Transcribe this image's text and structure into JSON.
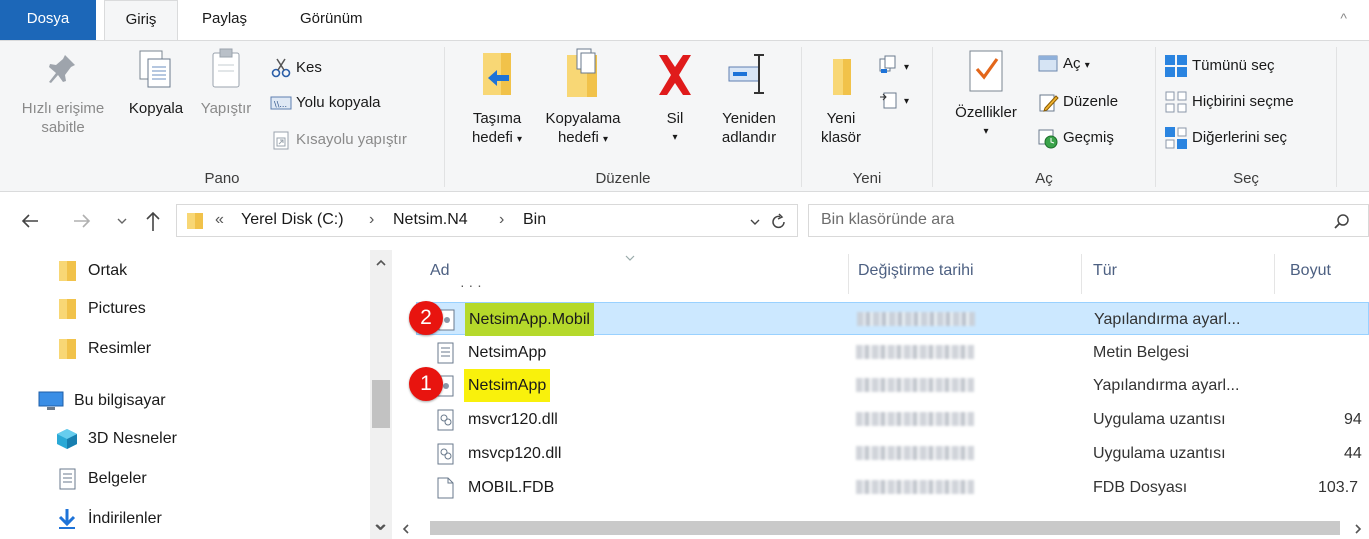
{
  "tabs": {
    "file": "Dosya",
    "home": "Giriş",
    "share": "Paylaş",
    "view": "Görünüm",
    "collapse": "^"
  },
  "ribbon": {
    "pano": {
      "label": "Pano",
      "pin_line1": "Hızlı erişime",
      "pin_line2": "sabitle",
      "copy": "Kopyala",
      "paste": "Yapıştır",
      "cut": "Kes",
      "copy_path": "Yolu kopyala",
      "paste_shortcut": "Kısayolu yapıştır"
    },
    "duzenle": {
      "label": "Düzenle",
      "move_line1": "Taşıma",
      "move_line2": "hedefi",
      "copyto_line1": "Kopyalama",
      "copyto_line2": "hedefi",
      "delete": "Sil",
      "rename_line1": "Yeniden",
      "rename_line2": "adlandır"
    },
    "yeni": {
      "label": "Yeni",
      "newfolder_line1": "Yeni",
      "newfolder_line2": "klasör"
    },
    "ac": {
      "label": "Aç",
      "properties": "Özellikler",
      "open": "Aç",
      "edit": "Düzenle",
      "history": "Geçmiş"
    },
    "sec": {
      "label": "Seç",
      "select_all": "Tümünü seç",
      "select_none": "Hiçbirini seçme",
      "invert": "Diğerlerini seç"
    },
    "dropdown_glyph": "▾"
  },
  "address": {
    "overflow": "«",
    "crumb1": "Yerel Disk (C:)",
    "crumb2": "Netsim.N4",
    "crumb3": "Bin",
    "sep": "›",
    "search_placeholder": "Bin klasöründe ara"
  },
  "nav": {
    "items": [
      {
        "label": "Ortak",
        "icon": "folder-icon"
      },
      {
        "label": "Pictures",
        "icon": "folder-icon"
      },
      {
        "label": "Resimler",
        "icon": "folder-icon"
      },
      {
        "label": "Bu bilgisayar",
        "icon": "computer-icon"
      },
      {
        "label": "3D Nesneler",
        "icon": "cube-icon"
      },
      {
        "label": "Belgeler",
        "icon": "document-icon"
      },
      {
        "label": "İndirilenler",
        "icon": "download-icon"
      }
    ]
  },
  "files": {
    "columns": {
      "name": "Ad",
      "date": "Değiştirme tarihi",
      "type": "Tür",
      "size": "Boyut"
    },
    "rows": [
      {
        "name": "NetsimApp.Mobil",
        "type": "Yapılandırma ayarl...",
        "size": "",
        "badge": "2",
        "selected": true
      },
      {
        "name": "NetsimApp",
        "type": "Metin Belgesi",
        "size": "",
        "badge": "",
        "selected": false
      },
      {
        "name": "NetsimApp",
        "type": "Yapılandırma ayarl...",
        "size": "",
        "badge": "1",
        "selected": false
      },
      {
        "name": "msvcr120.dll",
        "type": "Uygulama uzantısı",
        "size": "94",
        "badge": "",
        "selected": false
      },
      {
        "name": "msvcp120.dll",
        "type": "Uygulama uzantısı",
        "size": "44",
        "badge": "",
        "selected": false
      },
      {
        "name": "MOBIL.FDB",
        "type": "FDB Dosyası",
        "size": "103.7",
        "badge": "",
        "selected": false
      }
    ]
  },
  "colors": {
    "file_tab": "#1c67b8",
    "selection": "#cce8ff",
    "highlight_yellow": "#f9f10c",
    "highlight_green": "#b5d92b",
    "badge_red": "#e8140f"
  }
}
